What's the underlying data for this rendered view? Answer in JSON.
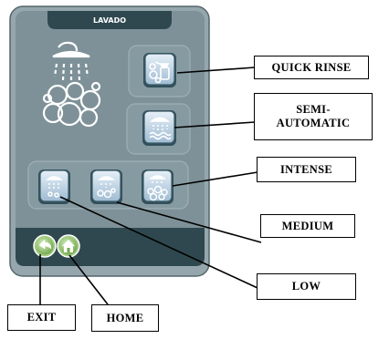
{
  "panel": {
    "title": "LAVADO"
  },
  "programs": {
    "quick_rinse": {
      "icon": "spray-bottle-icon",
      "label": "QUICK RINSE"
    },
    "semi_automatic": {
      "icon": "shower-water-icon",
      "label": "SEMI-\nAUTOMATIC"
    },
    "low": {
      "icon": "shower-low-bubbles-icon",
      "label": "LOW"
    },
    "medium": {
      "icon": "shower-medium-bubbles-icon",
      "label": "MEDIUM"
    },
    "intense": {
      "icon": "shower-intense-bubbles-icon",
      "label": "INTENSE"
    }
  },
  "footer": {
    "exit": {
      "icon": "back-arrow-icon",
      "label": "EXIT"
    },
    "home": {
      "icon": "home-icon",
      "label": "HOME"
    }
  },
  "colors": {
    "panel_bg": "#7e9198",
    "panel_dark": "#2f4850",
    "button_face": "#b9d1e2",
    "footer_button": "#8fc26a"
  }
}
